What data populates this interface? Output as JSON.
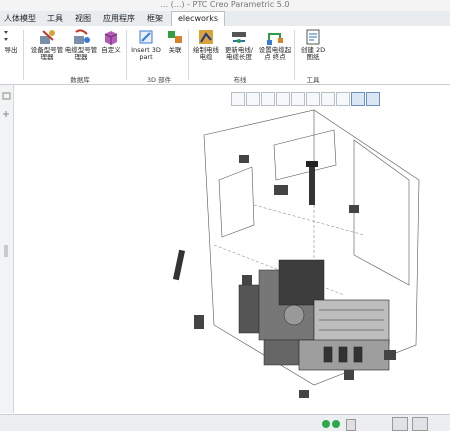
{
  "window": {
    "title": "... (...) - PTC Creo Parametric 5.0"
  },
  "tabs": [
    {
      "label": "人体模型"
    },
    {
      "label": "工具"
    },
    {
      "label": "视图"
    },
    {
      "label": "应用程序"
    },
    {
      "label": "框架"
    },
    {
      "label": "elecworks"
    }
  ],
  "ribbon": {
    "export_label": "导出",
    "buttons": [
      {
        "label": "设备型号管理器"
      },
      {
        "label": "电缆型号管理器"
      },
      {
        "label": "自定义"
      },
      {
        "label": "Insert 3D part"
      },
      {
        "label": "关联"
      },
      {
        "label": "绘制电线 电缆"
      },
      {
        "label": "更新电线/电缆长度"
      },
      {
        "label": "设置电缆起点 终点"
      },
      {
        "label": "创建 2D 图纸"
      }
    ],
    "groups": [
      {
        "label": "数据库"
      },
      {
        "label": "3D 部件"
      },
      {
        "label": "布线"
      },
      {
        "label": "工具"
      }
    ]
  },
  "view_toolbar": {
    "icons": [
      "refit-icon",
      "zoom-in-icon",
      "zoom-out-icon",
      "repaint-icon",
      "shading-icon",
      "saved-views-icon",
      "camera-icon",
      "datum-display-icon",
      "spin-center-icon",
      "orient-icon"
    ]
  },
  "colors": {
    "accent": "#2f6fb0",
    "tab_bg": "#e9ecef",
    "status_green": "#2ea84a"
  }
}
